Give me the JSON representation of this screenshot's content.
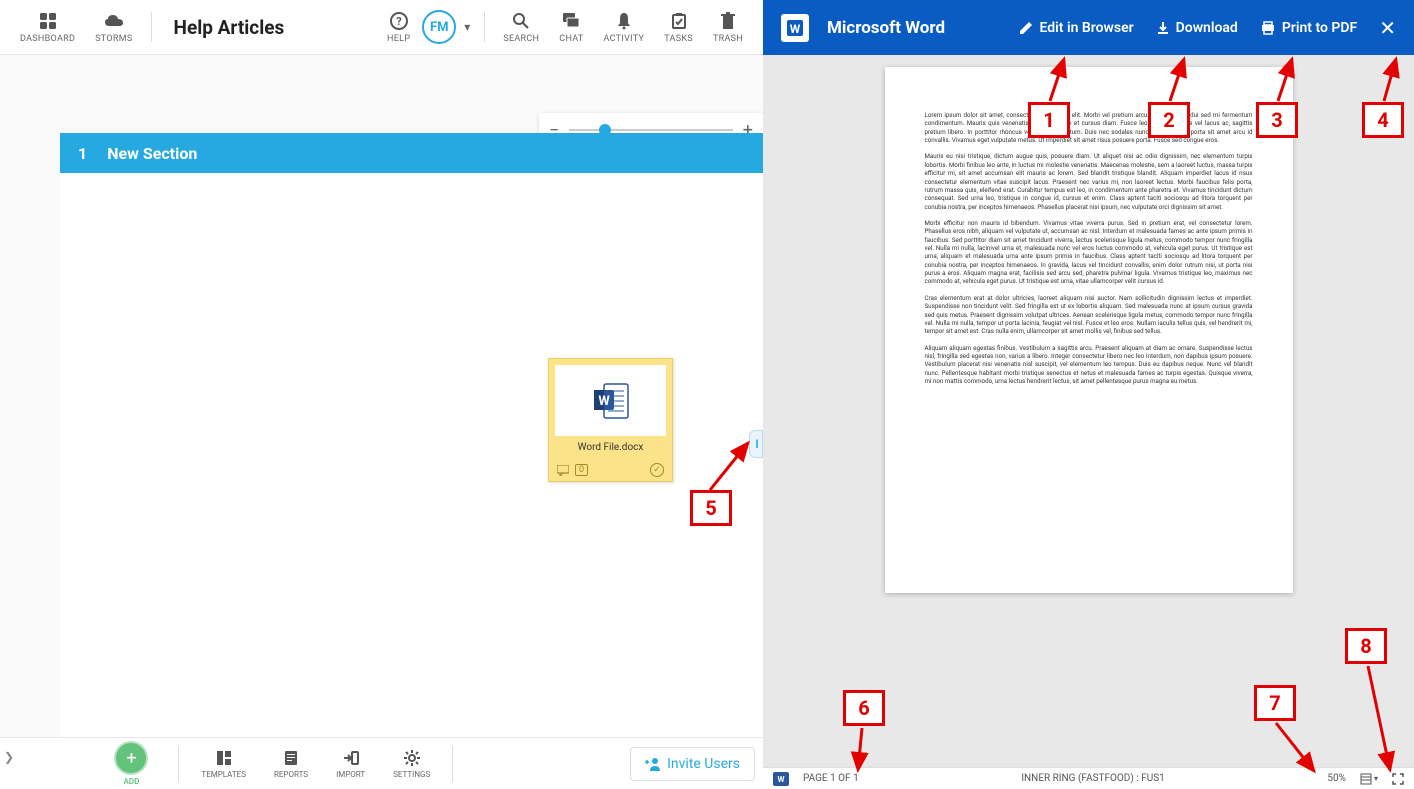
{
  "top_toolbar": {
    "dashboard": "DASHBOARD",
    "storms": "STORMS",
    "title": "Help Articles",
    "help": "HELP",
    "user_initials": "FM",
    "search": "SEARCH",
    "chat": "CHAT",
    "activity": "ACTIVITY",
    "tasks": "TASKS",
    "trash": "TRASH"
  },
  "section": {
    "number": "1",
    "title": "New Section"
  },
  "word_card": {
    "filename": "Word File.docx",
    "comment_count": "0"
  },
  "callouts": {
    "c1": "1",
    "c2": "2",
    "c3": "3",
    "c4": "4",
    "c5": "5",
    "c6": "6",
    "c7": "7",
    "c8": "8"
  },
  "bottom_bar": {
    "add": "ADD",
    "templates": "TEMPLATES",
    "reports": "REPORTS",
    "import": "IMPORT",
    "settings": "SETTINGS",
    "invite": "Invite Users"
  },
  "right_panel": {
    "title": "Microsoft Word",
    "edit": "Edit in Browser",
    "download": "Download",
    "print": "Print to PDF"
  },
  "document": {
    "p1": "Lorem ipsum dolor sit amet, consectetur adipiscing elit. Morbi vel pretium arcu. Aliquam quis dui sed mi fermentum condimentum. Mauris quis venenatis diam. Aliquam et cursus diam. Fusce leo augue, egestas vel lacus ac, sagittis pretium libero. In porttitor rhoncus velit nec fermentum. Duis nec sodales nunc. Pellentesque porta sit amet arcu id convallis. Vivamus eget vulputate metus. Ut imperdiet sit amet risus posuere porta. Fusce sed congue eros.",
    "p2": "Mauris eu nisi tristique, dictum augue quis, posuere diam. Ut aliquet nisi ac odio dignissim, nec elementum turpis lobortis. Morbi finibus leo ante, in luctus mi molestie venenatis. Maecenas molestie, sem a laoreet luctus, massa turpis efficitur mi, sit amet accumsan elit mauris ac lorem. Sed blandit tristique blandit. Aliquam imperdiet lacus id risus consectetur elementum vitae suscipit lacus. Praesent nec varius mi, non laoreet lectus. Morbi faucibus felis porta, rutrum massa quis, eleifend erat. Curabitur tempus est leo, in condimentum ante pharetra et. Vivamus tincidunt dictum consequat. Sed urna leo, tristique in congue id, cursus et enim. Class aptent taciti sociosqu ad litora torquent per conubia nostra, per inceptos himenaeos. Phasellus placerat nisi ipsum, nec vulputate orci dignissim sit amet.",
    "p3": "Morbi efficitur non mauris id bibendum. Vivamus vitae viverra purus. Sed in pretium erat, vel consectetur lorem. Phasellus eros nibh, aliquam vel vulputate ut, accumsan ac nisl. Interdum et malesuada fames ac ante ipsum primis in faucibus. Sed porttitor diam sit amet tincidunt viverra, lectus scelerisque ligula metus, commodo tempor nunc fringilla vel. Nulla mi nulla, lacinivel urna et, malesuada nunc vel eros luctus commodo at, vehicula eget purus. Ut tristique est urna, aliquam et malesuada urna ante ipsum primis in faucibus. Class aptent taciti sociosqu ad litora torquent per conubia nostra, per inceptos himenaeos. In gravida, lacus vel tincidunt convallis, enim dolor rutrum nisi, ut porta nisi purus a eros. Aliquam magna erat, facilisis sed arcu sed, pharetra pulvinar ligula. Vivamus tristique leo, maximus nec commodo at, vehicula eget purus. Ut tristique est urna, vitae ullamcorper velit cursus id.",
    "p4": "Cras elementum erat at dolor ultricies, laoreet aliquam nisi auctor. Nam sollicitudin dignissim lectus et imperdiet. Suspendisse non tincidunt velit. Sed fringilla est ut ex lobortis aliquam. Sed malesuada nunc at ipsum cursus gravida sed quis metus. Praesent dignissim volutpat ultrices. Aenean scelerisque ligula metus, commodo tempor nunc fringilla vel. Nulla mi nulla, tempor ut porta lacinia, feugiat vel nisl. Fusce et leo eros. Nullam iaculis tellus quis, vel hendrerit mi, tempor sit amet est. Cras nulla enim, ullamcorper sit amet mollis vel, finibus sed tellus.",
    "p5": "Aliquam aliquam egestas finibus. Vestibulum a sagittis arcu. Praesent aliquam at diam ac ornare. Suspendisse lectus nisl, fringilla sed egestas non, varius a libero. Integer consectetur libero nec leo interdum, non dapibus ipsum posuere. Vestibulum placerat nisi venenatis nisl suscipit, vel elementum leo tempus. Duis eu dapibus neque. Nunc vel blandit nunc. Pellentesque habitant morbi tristique senectus et netus et malesuada fames ac turpis egestas. Quisque viverra, mi non mattis commodo, urna lectus hendrerit lectus, sit amet pellentesque purus magna eu metus."
  },
  "status_bar": {
    "page": "PAGE 1 OF 1",
    "job": "INNER RING (FASTFOOD) : FUS1",
    "zoom": "50%"
  }
}
